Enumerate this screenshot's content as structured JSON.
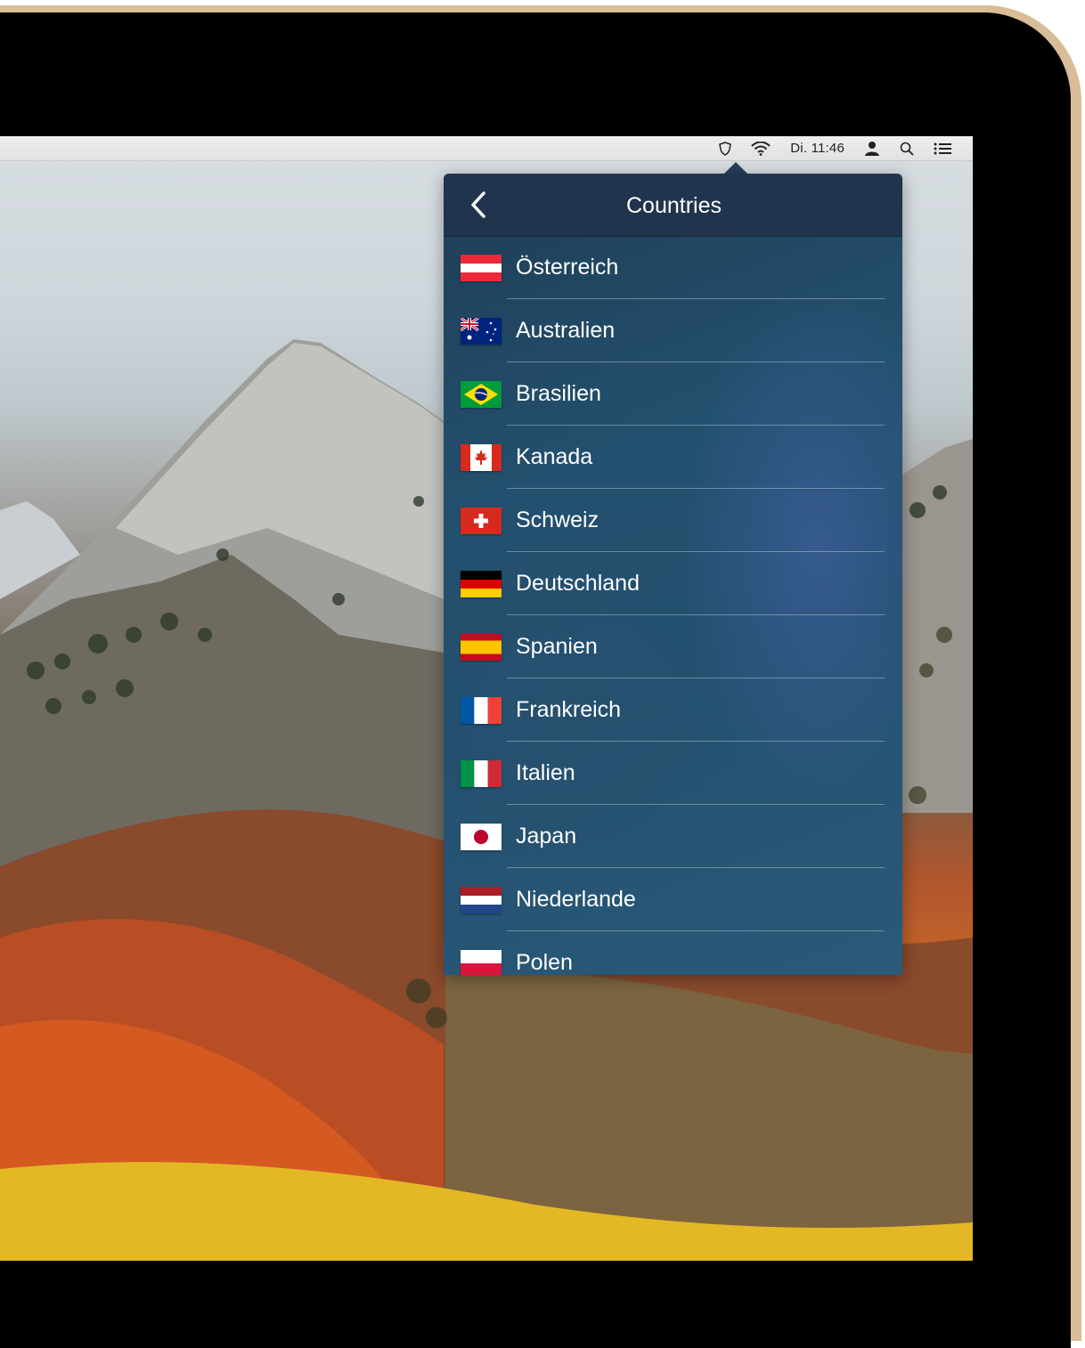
{
  "menubar": {
    "icons": [
      "vpn-shield-icon",
      "wifi-icon",
      "user-icon",
      "spotlight-search-icon",
      "notification-center-icon"
    ],
    "clock": "Di. 11:46"
  },
  "popover": {
    "title": "Countries",
    "back_icon": "chevron-left-icon",
    "countries": [
      {
        "name": "Österreich",
        "flag": "austria-flag-icon"
      },
      {
        "name": "Australien",
        "flag": "australia-flag-icon"
      },
      {
        "name": "Brasilien",
        "flag": "brazil-flag-icon"
      },
      {
        "name": "Kanada",
        "flag": "canada-flag-icon"
      },
      {
        "name": "Schweiz",
        "flag": "switzerland-flag-icon"
      },
      {
        "name": "Deutschland",
        "flag": "germany-flag-icon"
      },
      {
        "name": "Spanien",
        "flag": "spain-flag-icon"
      },
      {
        "name": "Frankreich",
        "flag": "france-flag-icon"
      },
      {
        "name": "Italien",
        "flag": "italy-flag-icon"
      },
      {
        "name": "Japan",
        "flag": "japan-flag-icon"
      },
      {
        "name": "Niederlande",
        "flag": "netherlands-flag-icon"
      },
      {
        "name": "Polen",
        "flag": "poland-flag-icon"
      }
    ]
  },
  "colors": {
    "bezel": "#000000",
    "shell": "#d9bd98",
    "popover_header": "#20354d",
    "popover_body": "#24506f"
  }
}
